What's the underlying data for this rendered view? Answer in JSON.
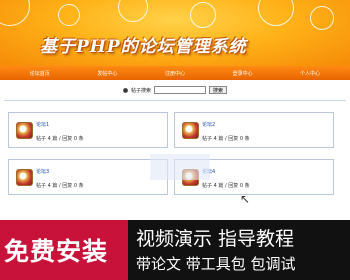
{
  "banner": {
    "title": "基于PHP的论坛管理系统"
  },
  "nav": {
    "items": [
      "论坛首页",
      "发帖中心",
      "注册中心",
      "登录中心",
      "个人中心"
    ]
  },
  "search": {
    "radio_label": "帖子搜索",
    "input_value": "",
    "button_label": "搜索"
  },
  "forums": [
    {
      "name": "论坛1",
      "stats": "帖子 4 篇 / 回复 0 条"
    },
    {
      "name": "论坛2",
      "stats": "帖子 4 篇 / 回复 0 条"
    },
    {
      "name": "论坛3",
      "stats": "帖子 4 篇 / 回复 0 条"
    },
    {
      "name": "论坛4",
      "stats": "帖子 4 篇 / 回复 0 条"
    }
  ],
  "ad": {
    "left": "免费安装",
    "line1": "视频演示 指导教程",
    "line2": "带论文 带工具包 包调试"
  },
  "colors": {
    "nav": "#e76400",
    "ad_red": "#c8123a",
    "ad_black": "#111111",
    "link": "#1a4ea8"
  }
}
